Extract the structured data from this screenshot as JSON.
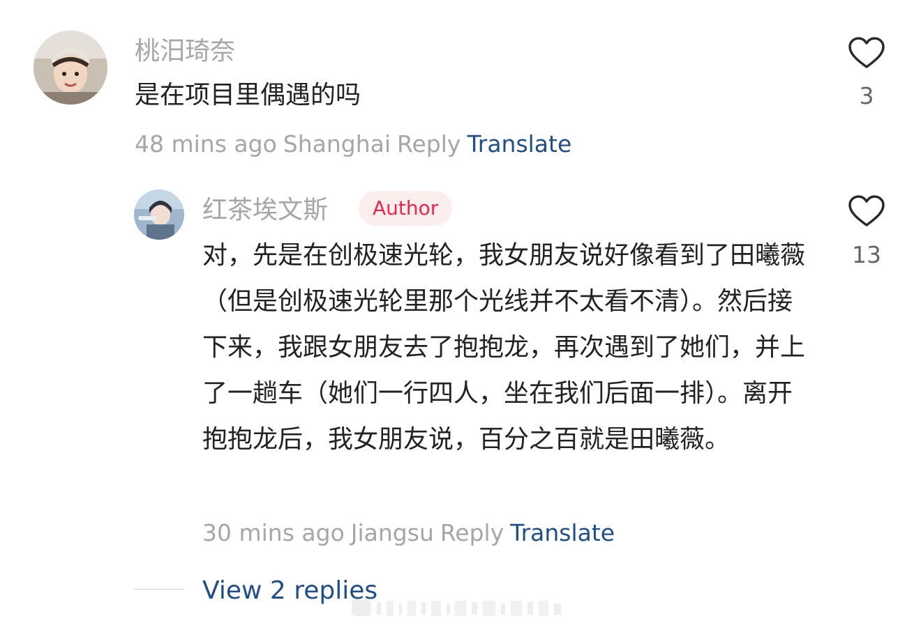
{
  "comments": [
    {
      "username": "桃汨琦奈",
      "text": "是在项目里偶遇的吗",
      "time": "48 mins ago",
      "location": "Shanghai",
      "reply_label": "Reply",
      "translate_label": "Translate",
      "likes": "3"
    },
    {
      "username": "红茶埃文斯",
      "badge": "Author",
      "text": "对，先是在创极速光轮，我女朋友说好像看到了田曦薇（但是创极速光轮里那个光线并不太看不清）。然后接下来，我跟女朋友去了抱抱龙，再次遇到了她们，并上了一趟车（她们一行四人，坐在我们后面一排）。离开抱抱龙后，我女朋友说，百分之百就是田曦薇。",
      "time": "30 mins ago",
      "location": "Jiangsu",
      "reply_label": "Reply",
      "translate_label": "Translate",
      "likes": "13"
    }
  ],
  "view_replies_label": "View 2 replies",
  "icons": {
    "like": "heart-outline-icon"
  },
  "colors": {
    "link": "#1f4e8a",
    "badge_text": "#f0244a",
    "badge_bg": "#fdeeee",
    "muted": "#a6a6a6"
  }
}
